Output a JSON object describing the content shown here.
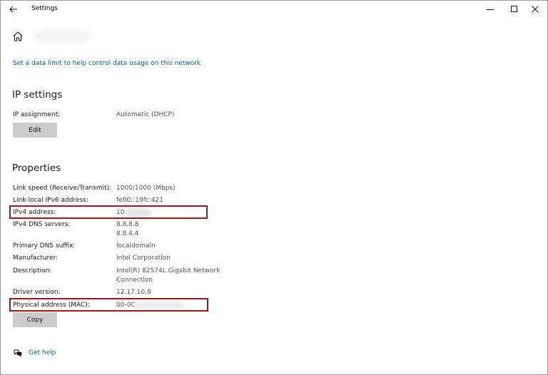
{
  "window": {
    "title": "Settings"
  },
  "header": {
    "page_title": ""
  },
  "data_limit_link": "Set a data limit to help control data usage on this network",
  "ip_settings": {
    "title": "IP settings",
    "assignment_label": "IP assignment:",
    "assignment_value": "Automatic (DHCP)",
    "edit_label": "Edit"
  },
  "properties": {
    "title": "Properties",
    "link_speed_label": "Link speed (Receive/Transmit):",
    "link_speed_value": "1000/1000 (Mbps)",
    "ipv6_label": "Link-local IPv6 address:",
    "ipv6_value": "fe80::19fc:421",
    "ipv4_label": "IPv4 address:",
    "ipv4_value": "10.",
    "dns_label": "IPv4 DNS servers:",
    "dns_value_1": "8.8.8.8",
    "dns_value_2": "8.8.4.4",
    "suffix_label": "Primary DNS suffix:",
    "suffix_value": "localdomain",
    "manufacturer_label": "Manufacturer:",
    "manufacturer_value": "Intel Corporation",
    "description_label": "Description:",
    "description_line_1": "Intel(R) 82574L Gigabit Network",
    "description_line_2": "Connection",
    "driver_label": "Driver version:",
    "driver_value": "12.17.10.8",
    "mac_label": "Physical address (MAC):",
    "mac_value": "00-0C",
    "copy_label": "Copy"
  },
  "help": {
    "label": "Get help"
  },
  "colors": {
    "link": "#0a5d9e",
    "highlight_box": "#8b1a2b",
    "button_bg": "#cccccc"
  },
  "icons": [
    "back-arrow-icon",
    "minimize-icon",
    "maximize-icon",
    "close-icon",
    "home-icon",
    "help-chat-icon"
  ]
}
